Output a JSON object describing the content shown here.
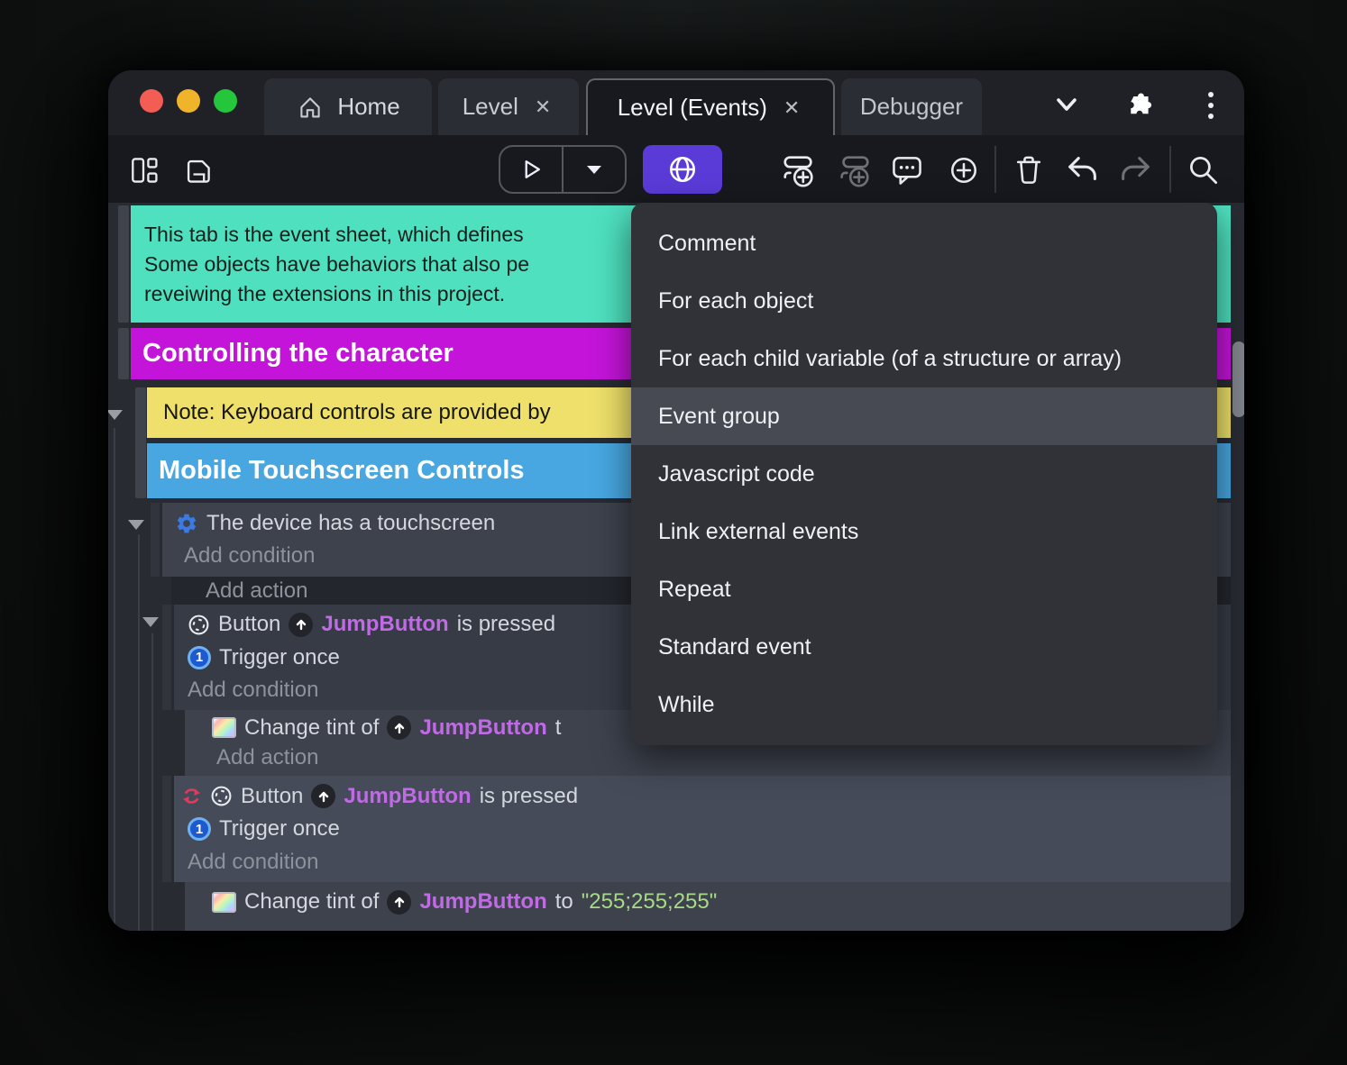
{
  "window": {
    "tabs": {
      "home": "Home",
      "level": "Level",
      "events": "Level (Events)",
      "debugger": "Debugger",
      "close_glyph": "✕"
    },
    "toolbar_icons": [
      "layout-icon",
      "save-icon",
      "play-icon",
      "dropdown-caret-icon",
      "globe-icon",
      "add-event-icon",
      "add-sub-event-icon",
      "comment-icon",
      "add-circle-icon",
      "trash-icon",
      "undo-icon",
      "redo-icon",
      "search-icon"
    ]
  },
  "event_sheet": {
    "comment": {
      "lines": [
        "This tab is the event sheet, which defines",
        "Some objects have behaviors that also pe",
        "reveiwing the extensions in this project."
      ]
    },
    "group_controlling": "Controlling the character",
    "note": "Note: Keyboard controls are provided by",
    "group_mobile": "Mobile Touchscreen Controls",
    "labels": {
      "add_condition": "Add condition",
      "add_action": "Add action"
    },
    "ev_touchscreen": {
      "text": "The device has a touchscreen"
    },
    "ev_button": {
      "object": "Button",
      "instance": "JumpButton",
      "rest": "is pressed",
      "trigger": "Trigger once"
    },
    "act_tint_partial": {
      "prefix": "Change tint of",
      "instance": "JumpButton",
      "rest": "t"
    },
    "act_tint_full": {
      "prefix": "Change tint of",
      "instance": "JumpButton",
      "to": "to",
      "value": "\"255;255;255\""
    },
    "icons": {
      "one": "1"
    }
  },
  "context_menu": {
    "highlighted": "Event group",
    "items": [
      {
        "label": "Comment"
      },
      {
        "label": "For each object"
      },
      {
        "label": "For each child variable (of a structure or array)"
      },
      {
        "label": "Event group"
      },
      {
        "label": "Javascript code"
      },
      {
        "label": "Link external events"
      },
      {
        "label": "Repeat"
      },
      {
        "label": "Standard event"
      },
      {
        "label": "While"
      }
    ]
  },
  "colors": {
    "accent_purple": "#5b3bd8",
    "comment_green": "#4ee0bf",
    "group_magenta": "#c414d9",
    "note_yellow": "#eee06a",
    "group_blue": "#48a7e1",
    "object_violet": "#c06ae6",
    "string_green": "#a8d98a",
    "menu_highlight": "#474a52",
    "invert_red": "#e23a5f",
    "gear_blue": "#3b79e3"
  }
}
